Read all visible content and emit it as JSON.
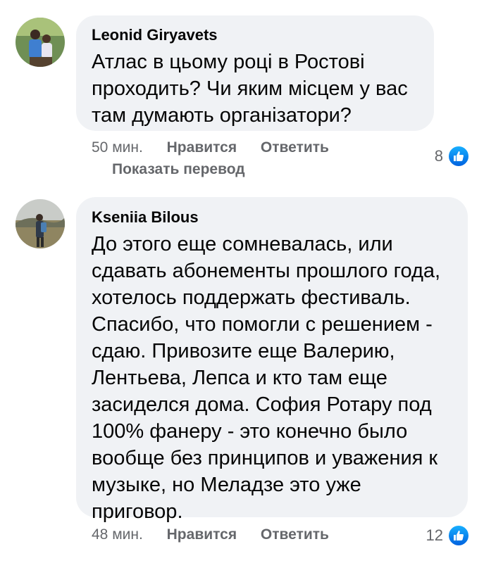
{
  "comments": [
    {
      "author": "Leonid Giryavets",
      "text": "Атлас в цьому році в Ростові проходить? Чи яким місцем у вас там думають організатори?",
      "time": "50 мин.",
      "like_label": "Нравится",
      "reply_label": "Ответить",
      "translate_label": "Показать перевод",
      "reactions": "8"
    },
    {
      "author": "Kseniia Bilous",
      "text": "До этого еще сомневалась, или сдавать абонементы прошлого года, хотелось поддержать фестиваль. Спасибо, что помогли с решением - сдаю. Привозите еще Валерию, Лентьева, Лепса и кто там еще засиделся дома. София Ротару под 100% фанеру - это конечно было вообще без принципов и уважения к музыке, но Меладзе это уже приговор.",
      "time": "48 мин.",
      "like_label": "Нравится",
      "reply_label": "Ответить",
      "reactions": "12"
    }
  ],
  "colors": {
    "bubble": "#f0f2f5",
    "meta": "#65676b",
    "like_blue": "#1877f2"
  },
  "icons": [
    "avatar-photo",
    "like-thumb-icon"
  ]
}
